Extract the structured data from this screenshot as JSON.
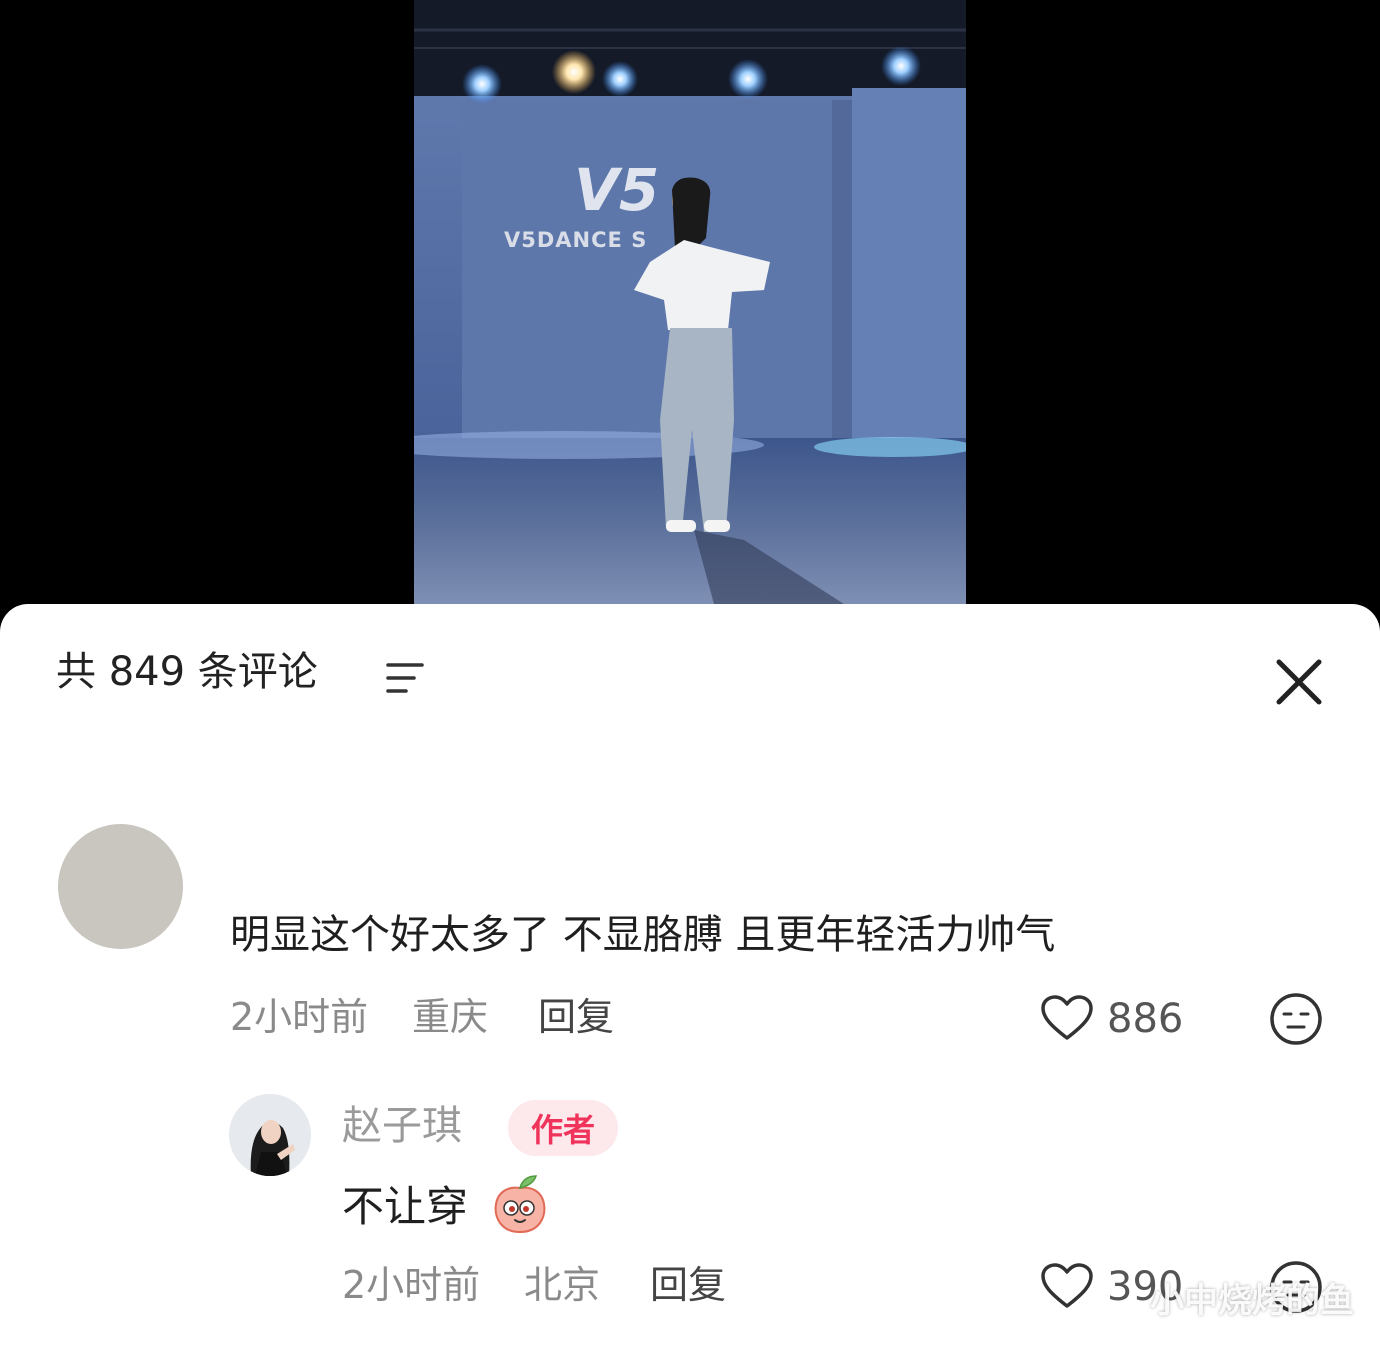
{
  "video": {
    "stage_logo_text": "V5DANCE S",
    "logo_mark": "V5"
  },
  "comments_panel": {
    "title": "共 849 条评论",
    "sort_icon": "sort-lines-icon",
    "close_icon": "close-icon"
  },
  "comment": {
    "text": "明显这个好太多了 不显胳膊 且更年轻活力帅气",
    "time": "2小时前",
    "location": "重庆",
    "reply_label": "回复",
    "likes": "886"
  },
  "reply": {
    "username": "赵子琪",
    "badge": "作者",
    "text": "不让穿",
    "time": "2小时前",
    "location": "北京",
    "reply_label": "回复",
    "likes": "390"
  },
  "watermark": "小中烧烤的鱼",
  "colors": {
    "badge_bg": "#fde8ec",
    "badge_text": "#f0335a",
    "sheet_bg": "#ffffff",
    "backdrop": "#000000"
  }
}
